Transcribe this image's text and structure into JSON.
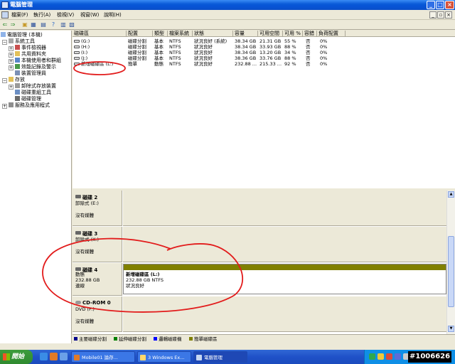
{
  "window": {
    "title": "電腦管理"
  },
  "menu": [
    "檔案(F)",
    "執行(A)",
    "檢視(V)",
    "視窗(W)",
    "說明(H)"
  ],
  "tree": {
    "items": [
      {
        "label": "電腦管理 (本機)",
        "level": 0,
        "exp": ""
      },
      {
        "label": "系統工具",
        "level": 1,
        "exp": "−"
      },
      {
        "label": "事件檢視器",
        "level": 2,
        "exp": "+"
      },
      {
        "label": "共用資料夾",
        "level": 2,
        "exp": "+"
      },
      {
        "label": "本機使用者和群組",
        "level": 2,
        "exp": "+"
      },
      {
        "label": "效能記錄及警示",
        "level": 2,
        "exp": "+"
      },
      {
        "label": "裝置管理員",
        "level": 2,
        "exp": ""
      },
      {
        "label": "存放",
        "level": 1,
        "exp": "−"
      },
      {
        "label": "卸除式存放裝置",
        "level": 2,
        "exp": "+"
      },
      {
        "label": "磁碟重組工具",
        "level": 2,
        "exp": ""
      },
      {
        "label": "磁碟管理",
        "level": 2,
        "exp": ""
      },
      {
        "label": "服務及應用程式",
        "level": 1,
        "exp": "+"
      }
    ]
  },
  "volume_list": {
    "columns": [
      "磁碟區",
      "配置",
      "類型",
      "檔案系統",
      "狀態",
      "容量",
      "可用空間",
      "可用 %",
      "容錯",
      "負荷配置"
    ],
    "rows": [
      [
        "(G:)",
        "磁碟分割",
        "基本",
        "NTFS",
        "狀況良好 (系統)",
        "38.34 GB",
        "21.31 GB",
        "55 %",
        "否",
        "0%"
      ],
      [
        "(H:)",
        "磁碟分割",
        "基本",
        "NTFS",
        "狀況良好",
        "38.34 GB",
        "33.93 GB",
        "88 %",
        "否",
        "0%"
      ],
      [
        "(I:)",
        "磁碟分割",
        "基本",
        "NTFS",
        "狀況良好",
        "38.34 GB",
        "13.20 GB",
        "34 %",
        "否",
        "0%"
      ],
      [
        "(J:)",
        "磁碟分割",
        "基本",
        "NTFS",
        "狀況良好",
        "38.36 GB",
        "33.76 GB",
        "88 %",
        "否",
        "0%"
      ],
      [
        "新增磁碟區 (L:)",
        "簡單",
        "動態",
        "NTFS",
        "狀況良好",
        "232.88 ...",
        "215.33 ...",
        "92 %",
        "否",
        "0%"
      ]
    ]
  },
  "disks": [
    {
      "name": "磁碟 2",
      "type": "卸除式 (E:)",
      "status": "沒有媒體"
    },
    {
      "name": "磁碟 3",
      "type": "卸除式 (K:)",
      "status": "沒有媒體"
    },
    {
      "name": "磁碟 4",
      "type": "動態",
      "size": "232.88 GB",
      "state": "連線",
      "volume": {
        "name": "新增磁碟區  (L:)",
        "detail": "232.88 GB NTFS",
        "status": "狀況良好"
      }
    },
    {
      "name": "CD-ROM 0",
      "type": "DVD (F:)",
      "status": "沒有媒體"
    }
  ],
  "legend": [
    {
      "label": "主要磁碟分割",
      "color": "#00008b"
    },
    {
      "label": "延伸磁碟分割",
      "color": "#008000"
    },
    {
      "label": "邏輯磁碟機",
      "color": "#0000ff"
    },
    {
      "label": "簡單磁碟區",
      "color": "#808000"
    }
  ],
  "taskbar": {
    "start": "開始",
    "tasks": [
      "Mobile01 論存...",
      "3 Windows Ex...",
      "電腦管理"
    ],
    "watermark": "#1006626"
  }
}
